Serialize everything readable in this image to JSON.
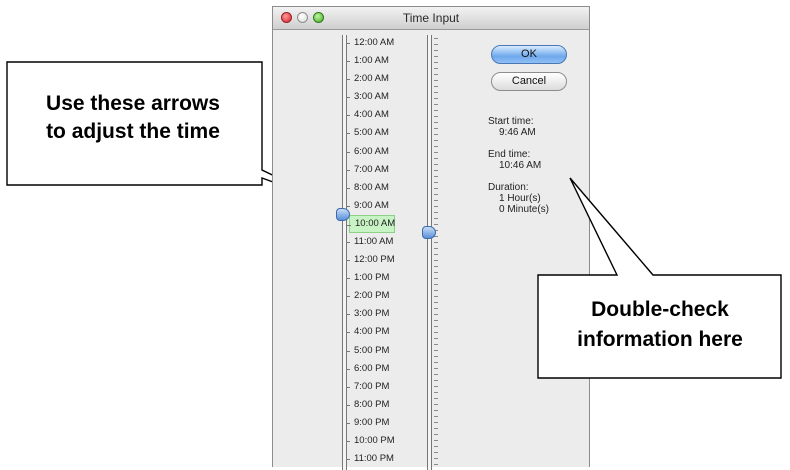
{
  "window": {
    "title": "Time Input"
  },
  "time_labels": [
    "12:00 AM",
    "1:00 AM",
    "2:00 AM",
    "3:00 AM",
    "4:00 AM",
    "5:00 AM",
    "6:00 AM",
    "7:00 AM",
    "8:00 AM",
    "9:00 AM",
    "10:00 AM",
    "11:00 AM",
    "12:00 PM",
    "1:00 PM",
    "2:00 PM",
    "3:00 PM",
    "4:00 PM",
    "5:00 PM",
    "6:00 PM",
    "7:00 PM",
    "8:00 PM",
    "9:00 PM",
    "10:00 PM",
    "11:00 PM"
  ],
  "selected_time": "10:00 AM",
  "buttons": {
    "ok": "OK",
    "cancel": "Cancel"
  },
  "info": {
    "start_label": "Start time:",
    "start_value": "9:46 AM",
    "end_label": "End time:",
    "end_value": "10:46 AM",
    "duration_label": "Duration:",
    "duration_hours": "1 Hour(s)",
    "duration_minutes": "0   Minute(s)"
  },
  "annotations": {
    "left_line1": "Use these arrows",
    "left_line2": "to adjust the time",
    "right_line1": "Double-check",
    "right_line2": "information here"
  },
  "colors": {
    "selected_highlight": "#c8f3c4",
    "ok_button": "#6fa8ec"
  }
}
